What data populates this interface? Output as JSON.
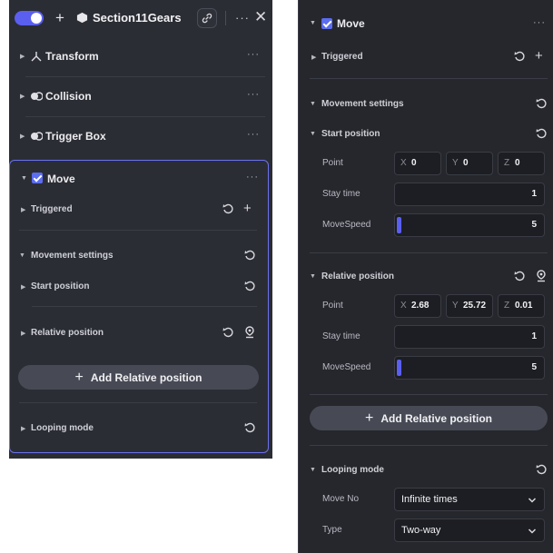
{
  "left": {
    "header": {
      "title": "Section11Gears",
      "add": "+",
      "more": "···",
      "close": "✕"
    },
    "sections": [
      {
        "label": "Transform",
        "icon": "transform-icon",
        "more": "···"
      },
      {
        "label": "Collision",
        "icon": "collision-icon",
        "more": "···"
      },
      {
        "label": "Trigger Box",
        "icon": "trigger-box-icon",
        "more": "···"
      }
    ],
    "move": {
      "label": "Move",
      "more": "···",
      "checked": true,
      "triggered": "Triggered",
      "movement_settings": "Movement settings",
      "start_position": "Start position",
      "relative_position": "Relative position",
      "add_relative": "Add Relative position",
      "looping_mode": "Looping mode"
    }
  },
  "right": {
    "move_label": "Move",
    "more": "···",
    "triggered": "Triggered",
    "movement_settings": "Movement settings",
    "start": {
      "label": "Start position",
      "point_label": "Point",
      "x": "0",
      "y": "0",
      "z": "0",
      "stay_label": "Stay time",
      "stay": "1",
      "speed_label": "MoveSpeed",
      "speed": "5"
    },
    "relative": {
      "label": "Relative position",
      "point_label": "Point",
      "x": "2.68",
      "y": "25.72",
      "z": "0.01",
      "stay_label": "Stay time",
      "stay": "1",
      "speed_label": "MoveSpeed",
      "speed": "5"
    },
    "add_relative": "Add Relative position",
    "looping": {
      "label": "Looping mode",
      "move_no_label": "Move No",
      "move_no": "Infinite times",
      "type_label": "Type",
      "type": "Two-way"
    },
    "axis": {
      "x": "X",
      "y": "Y",
      "z": "Z"
    }
  },
  "colors": {
    "accent": "#5b5ff0",
    "panel": "#2b2d34",
    "border": "#6a72f0"
  }
}
